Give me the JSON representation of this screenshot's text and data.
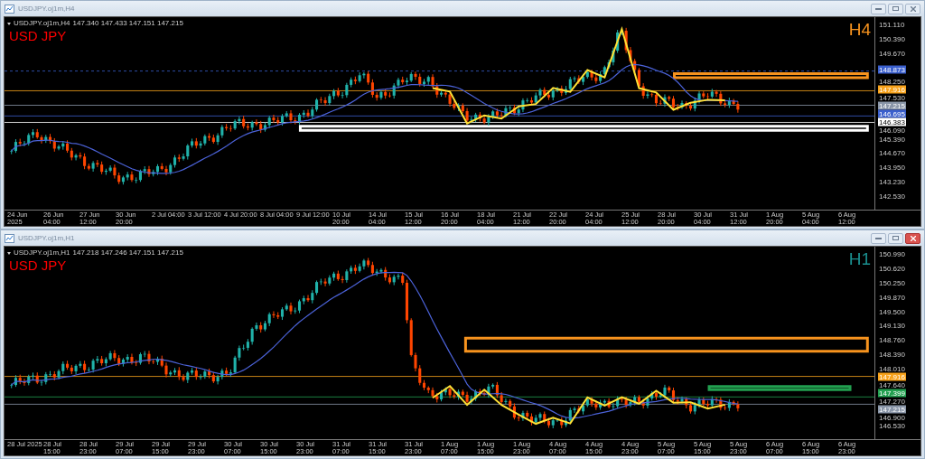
{
  "windows": [
    {
      "title": "USDJPY.oj1m,H4",
      "active": false,
      "header": {
        "symbol": "USDJPY.oj1m,H4",
        "quotes": "147.340 147.433 147.151 147.215"
      },
      "label": "USD JPY",
      "timeframe": {
        "text": "H4",
        "color": "#f7931e"
      },
      "price_axis": [
        {
          "text": "151.110"
        },
        {
          "text": "150.390"
        },
        {
          "text": "149.670"
        },
        {
          "text": "148.873",
          "color": "#3a5fcd"
        },
        {
          "text": "148.250"
        },
        {
          "text": "147.916",
          "color": "#f7a21b"
        },
        {
          "text": "147.530"
        },
        {
          "text": "147.215",
          "color": "#8a96a8"
        },
        {
          "text": "146.695",
          "color": "#3a5fcd"
        },
        {
          "text": "146.383",
          "color": "#ffffff"
        },
        {
          "text": "146.090"
        },
        {
          "text": "145.390"
        },
        {
          "text": "144.670"
        },
        {
          "text": "143.950"
        },
        {
          "text": "143.230"
        },
        {
          "text": "142.530"
        }
      ],
      "time_axis": [
        "24 Jun 2025",
        "26 Jun 04:00",
        "27 Jun 12:00",
        "30 Jun 20:00",
        "2 Jul 04:00",
        "3 Jul 12:00",
        "4 Jul 20:00",
        "8 Jul 04:00",
        "9 Jul 12:00",
        "10 Jul 20:00",
        "14 Jul 04:00",
        "15 Jul 12:00",
        "16 Jul 20:00",
        "18 Jul 04:00",
        "21 Jul 12:00",
        "22 Jul 20:00",
        "24 Jul 04:00",
        "25 Jul 12:00",
        "28 Jul 20:00",
        "30 Jul 04:00",
        "31 Jul 12:00",
        "1 Aug 20:00",
        "5 Aug 04:00",
        "6 Aug 12:00"
      ]
    },
    {
      "title": "USDJPY.oj1m,H1",
      "active": true,
      "header": {
        "symbol": "USDJPY.oj1m,H1",
        "quotes": "147.218 147.246 147.151 147.215"
      },
      "label": "USD JPY",
      "timeframe": {
        "text": "H1",
        "color": "#1a8f8f"
      },
      "price_axis": [
        {
          "text": "150.990"
        },
        {
          "text": "150.620"
        },
        {
          "text": "150.250"
        },
        {
          "text": "149.870"
        },
        {
          "text": "149.500"
        },
        {
          "text": "149.130"
        },
        {
          "text": "148.760"
        },
        {
          "text": "148.390"
        },
        {
          "text": "148.010"
        },
        {
          "text": "147.916",
          "color": "#f7a21b"
        },
        {
          "text": "147.640"
        },
        {
          "text": "147.399",
          "color": "#22a050"
        },
        {
          "text": "147.270"
        },
        {
          "text": "147.215",
          "color": "#8a96a8"
        },
        {
          "text": "146.900"
        },
        {
          "text": "146.530"
        }
      ],
      "time_axis": [
        "28 Jul 2025",
        "28 Jul 15:00",
        "28 Jul 23:00",
        "29 Jul 07:00",
        "29 Jul 15:00",
        "29 Jul 23:00",
        "30 Jul 07:00",
        "30 Jul 15:00",
        "30 Jul 23:00",
        "31 Jul 07:00",
        "31 Jul 15:00",
        "31 Jul 23:00",
        "1 Aug 07:00",
        "1 Aug 15:00",
        "1 Aug 23:00",
        "4 Aug 07:00",
        "4 Aug 15:00",
        "4 Aug 23:00",
        "5 Aug 07:00",
        "5 Aug 15:00",
        "5 Aug 23:00",
        "6 Aug 07:00",
        "6 Aug 15:00",
        "6 Aug 23:00"
      ]
    }
  ]
}
